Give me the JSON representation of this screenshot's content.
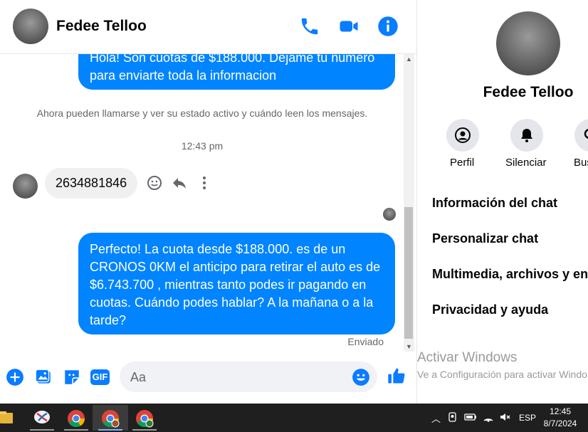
{
  "header": {
    "name": "Fedee Telloo"
  },
  "messages": {
    "out1": "Hola! Son cuotas de $188.000. Dejame tu numero para enviarte toda la informacion",
    "system": "Ahora pueden llamarse y ver su estado activo y cuándo leen los mensajes.",
    "time": "12:43 pm",
    "in1": "2634881846",
    "out2": "Perfecto! La cuota desde $188.000. es de un CRONOS 0KM el anticipo para retirar el auto es de $6.743.700 , mientras tanto podes ir pagando en cuotas. Cuándo podes hablar? A la mañana o a la tarde?",
    "status": "Enviado"
  },
  "composer": {
    "placeholder": "Aa",
    "gif_label": "GIF"
  },
  "panel": {
    "name": "Fedee Telloo",
    "buttons": [
      {
        "label": "Perfil"
      },
      {
        "label": "Silenciar"
      },
      {
        "label": "Bus"
      }
    ],
    "menu": [
      {
        "label": "Información del chat"
      },
      {
        "label": "Personalizar chat"
      },
      {
        "label": "Multimedia, archivos y en"
      },
      {
        "label": "Privacidad y ayuda"
      }
    ]
  },
  "watermark": {
    "line1": "Activar Windows",
    "line2": "Ve a Configuración para activar Windo"
  },
  "taskbar": {
    "language": "ESP",
    "time": "12:45",
    "date": "8/7/2024"
  },
  "colors": {
    "accent": "#0084ff",
    "brand_icon": "#0a7cff"
  }
}
